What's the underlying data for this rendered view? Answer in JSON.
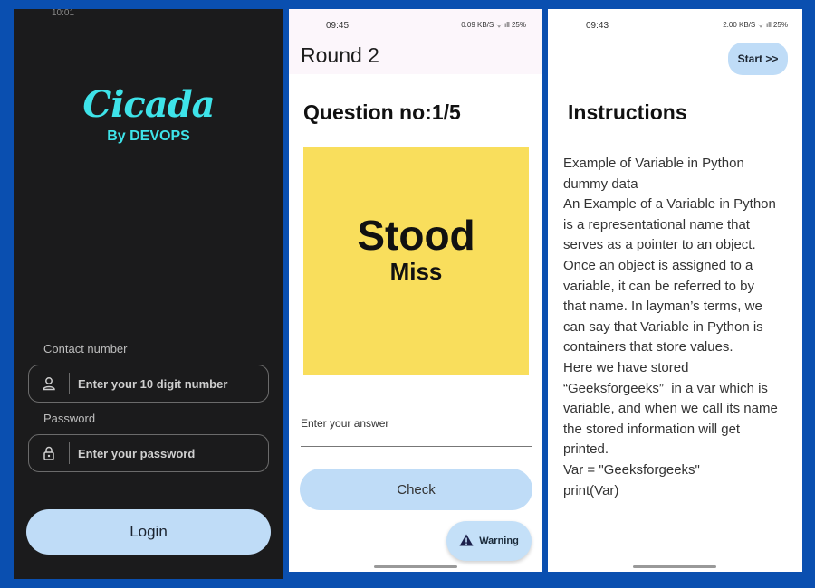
{
  "login_screen": {
    "status_time": "10:01",
    "app_name": "Cicada",
    "byline": "By DEVOPS",
    "contact_label": "Contact number",
    "contact_placeholder": "Enter your 10 digit  number",
    "password_label": "Password",
    "password_placeholder": "Enter your password",
    "login_button": "Login",
    "accent_color": "#3ee3e9"
  },
  "round_screen": {
    "status_time": "09:45",
    "status_right": "0.09 KB/S  ᯤ  ıll 25%",
    "title": "Round 2",
    "question_number": "Question no:1/5",
    "puzzle_word_1": "Stood",
    "puzzle_word_2": "Miss",
    "answer_label": "Enter your answer",
    "check_button": "Check",
    "warning_button": "Warning",
    "puzzle_color": "#f9de5c"
  },
  "instructions_screen": {
    "status_time": "09:43",
    "status_right": "2.00 KB/S  ᯤ  ıll 25%",
    "start_button": "Start >>",
    "title": "Instructions",
    "body_lines": [
      "Example of Variable in Python",
      "",
      "dummy data",
      "An Example of a Variable in Python",
      "is a representational name that",
      "serves as a pointer to an object.",
      "Once an object is assigned to a",
      "variable, it can be referred to by",
      "that name. In layman’s terms, we",
      "can say that Variable in Python is",
      "containers that store values.",
      "",
      "Here we have stored",
      "“Geeksforgeeks”  in a var which is",
      "variable, and when we call its name",
      "the stored information will get",
      "printed.",
      "",
      "Var = \"Geeksforgeeks\"",
      "print(Var)"
    ]
  }
}
